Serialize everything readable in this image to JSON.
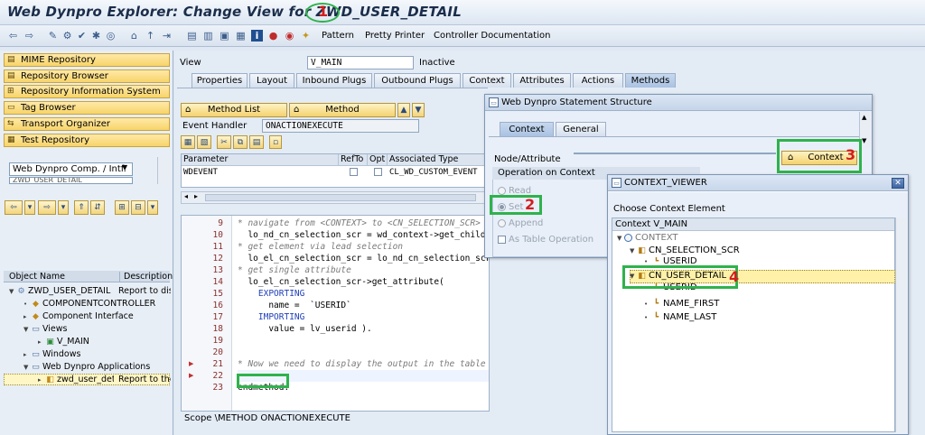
{
  "window": {
    "title": "Web Dynpro Explorer: Change View for ZWD_USER_DETAIL"
  },
  "toolbar": {
    "pattern_label": "Pattern",
    "pretty_printer_label": "Pretty Printer",
    "controller_doc_label": "Controller Documentation"
  },
  "nav": {
    "buttons": [
      "MIME Repository",
      "Repository Browser",
      "Repository Information System",
      "Tag Browser",
      "Transport Organizer",
      "Test Repository"
    ],
    "object_type_select": "Web Dynpro Comp. / Intf.",
    "object_name_partial": "ZWD_USER_DETAIL",
    "tree_header_name": "Object Name",
    "tree_header_desc": "Description",
    "tree": [
      {
        "label": "ZWD_USER_DETAIL",
        "desc": "Report to display"
      },
      {
        "label": "COMPONENTCONTROLLER",
        "desc": ""
      },
      {
        "label": "Component Interface",
        "desc": ""
      },
      {
        "label": "Views",
        "desc": ""
      },
      {
        "label": "V_MAIN",
        "desc": ""
      },
      {
        "label": "Windows",
        "desc": ""
      },
      {
        "label": "Web Dynpro Applications",
        "desc": ""
      },
      {
        "label": "zwd_user_detail",
        "desc": "Report to the"
      }
    ]
  },
  "view": {
    "label": "View",
    "name": "V_MAIN",
    "status": "Inactive",
    "tabs": [
      "Properties",
      "Layout",
      "Inbound Plugs",
      "Outbound Plugs",
      "Context",
      "Attributes",
      "Actions",
      "Methods"
    ],
    "method_list_label": "Method List",
    "method_label": "Method",
    "event_handler_label": "Event Handler",
    "event_handler_value": "ONACTIONEXECUTE"
  },
  "params": {
    "headers": [
      "Parameter",
      "RefTo",
      "Opt",
      "Associated Type"
    ],
    "rows": [
      {
        "parameter": "WDEVENT",
        "type": "CL_WD_CUSTOM_EVENT"
      }
    ]
  },
  "code": {
    "lines": [
      {
        "num": "9",
        "text": "* navigate from <CONTEXT> to <CN_SELECTION_SCR>"
      },
      {
        "num": "10",
        "text": "  lo_nd_cn_selection_scr = wd_context->get_child_node("
      },
      {
        "num": "11",
        "text": "* get element via lead selection"
      },
      {
        "num": "12",
        "text": "  lo_el_cn_selection_scr = lo_nd_cn_selection_scr->get_element( )."
      },
      {
        "num": "13",
        "text": "* get single attribute"
      },
      {
        "num": "14",
        "text": "  lo_el_cn_selection_scr->get_attribute("
      },
      {
        "num": "15",
        "text": "    EXPORTING"
      },
      {
        "num": "16",
        "text": "      name =  `USERID`"
      },
      {
        "num": "17",
        "text": "    IMPORTING"
      },
      {
        "num": "18",
        "text": "      value = lv_userid )."
      },
      {
        "num": "19",
        "text": ""
      },
      {
        "num": "20",
        "text": ""
      },
      {
        "num": "21",
        "text": "* Now we need to display the output in the table"
      },
      {
        "num": "22",
        "text": ""
      },
      {
        "num": "23",
        "text": "endmethod."
      }
    ],
    "scope": "Scope \\METHOD ONACTIONEXECUTE"
  },
  "statement_dialog": {
    "title": "Web Dynpro Statement Structure",
    "tabs": [
      "Context",
      "General"
    ],
    "node_attr_label": "Node/Attribute",
    "context_button": "Context",
    "operation_group": "Operation on Context",
    "options": [
      "Read",
      "Set",
      "Append"
    ],
    "table_op_label": "As Table Operation"
  },
  "context_viewer": {
    "title": "CONTEXT_VIEWER",
    "heading": "Choose Context Element",
    "column_header": "Context V_MAIN",
    "tree": [
      "CONTEXT",
      "CN_SELECTION_SCR",
      "USERID",
      "CN_USER_DETAIL",
      "USERID",
      "NAME_FIRST",
      "NAME_LAST"
    ]
  },
  "annotations": [
    "1",
    "2",
    "3",
    "4"
  ]
}
